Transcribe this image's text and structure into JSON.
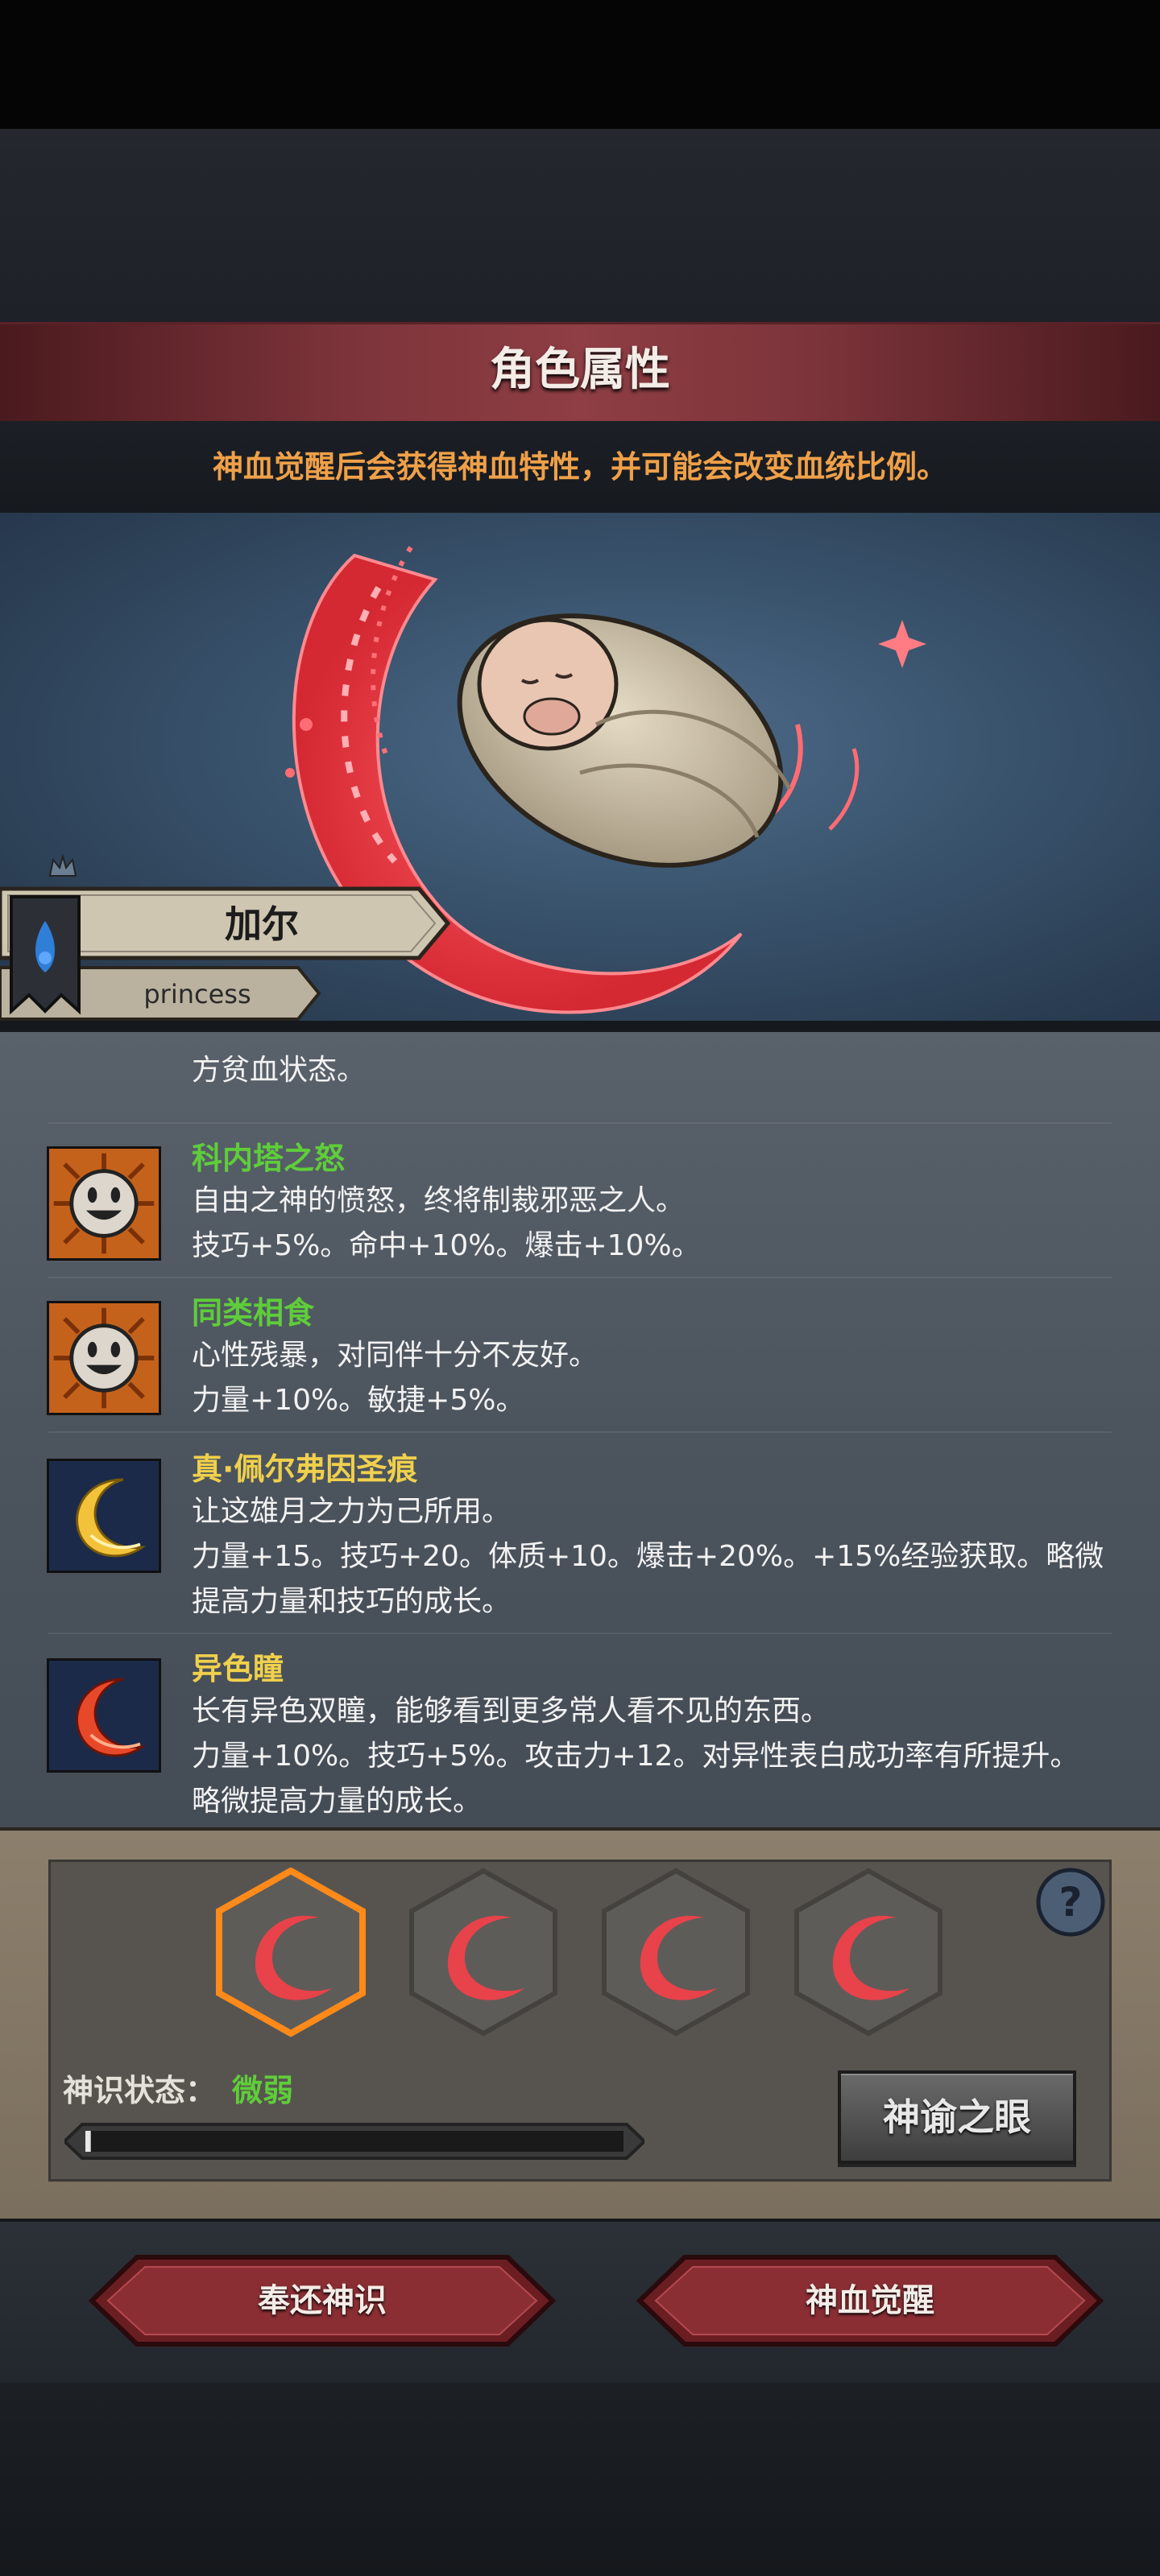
{
  "page": {
    "title": "角色属性",
    "hint": "神血觉醒后会获得神血特性，并可能会改变血统比例。"
  },
  "character": {
    "name": "加尔",
    "subtitle": "princess"
  },
  "traits": [
    {
      "name": "",
      "name_color": "green",
      "icon": "partial-hidden",
      "lines": [
        "方贫血状态。"
      ]
    },
    {
      "name": "科内塔之怒",
      "name_color": "green",
      "icon": "smile-face-icon",
      "lines": [
        "自由之神的愤怒，终将制裁邪恶之人。",
        "技巧+5%。命中+10%。爆击+10%。"
      ]
    },
    {
      "name": "同类相食",
      "name_color": "green",
      "icon": "smile-face-icon",
      "lines": [
        "心性残暴，对同伴十分不友好。",
        "力量+10%。敏捷+5%。"
      ]
    },
    {
      "name": "真·佩尔弗因圣痕",
      "name_color": "yellow",
      "icon": "crescent-moon-icon",
      "lines": [
        "让这雄月之力为己所用。",
        "力量+15。技巧+20。体质+10。爆击+20%。+15%经验获取。略微",
        "提高力量和技巧的成长。"
      ]
    },
    {
      "name": "异色瞳",
      "name_color": "yellow",
      "icon": "red-crescent-icon",
      "lines": [
        "长有异色双瞳，能够看到更多常人看不见的东西。",
        "力量+10%。技巧+5%。攻击力+12。对异性表白成功率有所提升。",
        "略微提高力量的成长。"
      ]
    }
  ],
  "awaken": {
    "slots": 4,
    "selected_slot": 1,
    "status_label": "神识状态：",
    "status_value": "微弱",
    "progress": 0.01,
    "oracle_button": "神谕之眼"
  },
  "buttons": {
    "return_label": "奉还神识",
    "awaken_label": "神血觉醒"
  },
  "colors": {
    "accent_green": "#5fcd3a",
    "accent_yellow": "#f0d04c",
    "hint_orange": "#f0a048",
    "title_red": "#8e3e44"
  }
}
